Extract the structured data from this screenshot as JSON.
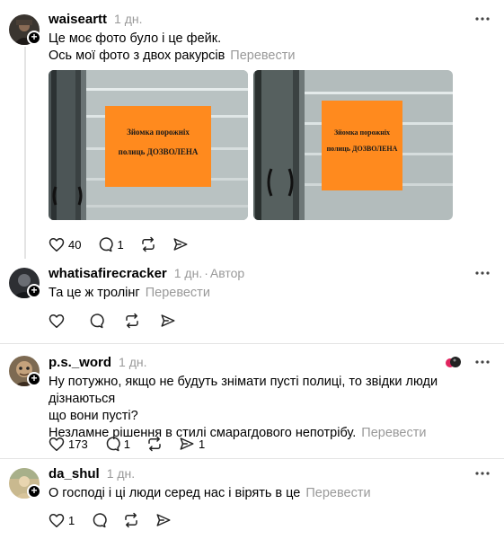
{
  "posts": [
    {
      "username": "waiseartt",
      "time": "1 дн.",
      "lines": [
        "Це моє фото було і це фейк.",
        "Ось мої фото з двох ракурсів"
      ],
      "translate": "Перевести",
      "photos": [
        {
          "sign_line1": "Зйомка порожніх",
          "sign_line2": "полиць ДОЗВОЛЕНА"
        },
        {
          "sign_line1": "Зйомка порожніх",
          "sign_line2": "полиць ДОЗВОЛЕНА"
        }
      ],
      "likes": "40",
      "replies": "1",
      "reposts": "",
      "shares": ""
    },
    {
      "username": "whatisafirecracker",
      "time": "1 дн.",
      "author": "Автор",
      "lines": [
        "Та це ж тролінг"
      ],
      "translate": "Перевести",
      "likes": "",
      "replies": "",
      "reposts": "",
      "shares": ""
    },
    {
      "username": "p.s._word",
      "time": "1 дн.",
      "lines": [
        "Ну потужно, якщо не будуть знімати пусті полиці, то звідки люди дізнаються",
        "що вони пусті?",
        "Незламне рішення в стилі смарагдового непотрібу."
      ],
      "translate": "Перевести",
      "likes": "173",
      "replies": "1",
      "reposts": "",
      "shares": "1"
    },
    {
      "username": "da_shul",
      "time": "1 дн.",
      "lines": [
        "О господі і ці люди серед нас і вірять в це"
      ],
      "translate": "Перевести",
      "likes": "1",
      "replies": "",
      "reposts": "",
      "shares": ""
    }
  ],
  "colors": {
    "sign_orange": "#ff8a1e",
    "meta_gray": "#999999",
    "divider": "#e4e4e4"
  },
  "icons": [
    "plus-icon",
    "more-icon",
    "heart-icon",
    "comment-icon",
    "repost-icon",
    "share-icon",
    "reaction-icon"
  ]
}
